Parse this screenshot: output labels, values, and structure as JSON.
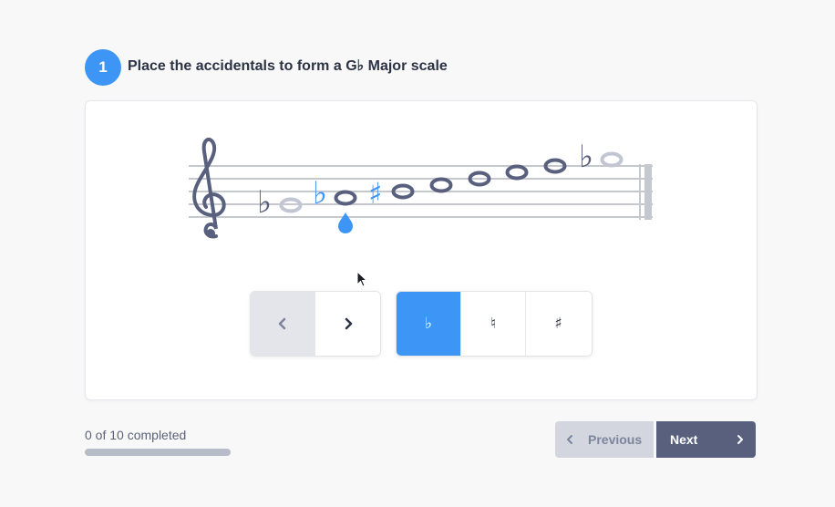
{
  "step": {
    "number": "1",
    "title": "Place the accidentals to form a G♭ Major scale"
  },
  "accidental_buttons": {
    "flat": "♭",
    "natural": "♮",
    "sharp": "♯"
  },
  "progress": {
    "label": "0 of 10 completed",
    "completed": 0,
    "total": 10
  },
  "navigation": {
    "previous_label": "Previous",
    "next_label": "Next"
  },
  "colors": {
    "accent": "#3d96f5",
    "ink": "#58607e",
    "ghost": "#c1c6d2",
    "staff": "#c6c8d0"
  },
  "icons": {
    "clef": "treble-clef-icon",
    "prev": "chevron-left-icon",
    "next": "chevron-right-icon",
    "cursor": "mouse-pointer-icon",
    "drop": "drop-cursor-icon"
  }
}
